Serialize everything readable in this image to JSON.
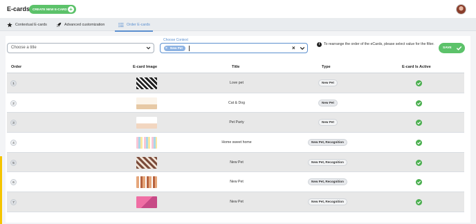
{
  "header": {
    "app_title": "E-cards",
    "create_button": "CREATE NEW E-CARD",
    "avatar_icon": "user-avatar"
  },
  "tabs": [
    {
      "label": "Contextual E-cards",
      "icon": "star-icon",
      "active": false
    },
    {
      "label": "Advanced customization",
      "icon": "rocket-icon",
      "active": false
    },
    {
      "label": "Order E-cards",
      "icon": "list-icon",
      "active": true
    }
  ],
  "filters": {
    "title_placeholder": "Choose a title",
    "context_label": "Choose Context",
    "context_chip": "New Pet",
    "info_text": "To rearrange the order of the eCards, please select value for the filter.",
    "save_label": "SAVE"
  },
  "table": {
    "columns": [
      "Order",
      "E-card Image",
      "Title",
      "Type",
      "E-card Is Active"
    ],
    "rows": [
      {
        "order": "1",
        "title": "Love pet",
        "type": "New Pet",
        "active": true
      },
      {
        "order": "2",
        "title": "Cat & Dog",
        "type": "New Pet",
        "active": true
      },
      {
        "order": "3",
        "title": "Pet Party",
        "type": "New Pet",
        "active": true
      },
      {
        "order": "4",
        "title": "Home sweet home",
        "type": "New Pet, Recognition",
        "active": true
      },
      {
        "order": "5",
        "title": "New Pet",
        "type": "New Pet, Recognition",
        "active": true
      },
      {
        "order": "6",
        "title": "New Pet",
        "type": "New Pet, Recognition",
        "active": true
      },
      {
        "order": "7",
        "title": "New Pet",
        "type": "New Pet, Recognition",
        "active": true
      }
    ]
  },
  "colors": {
    "accent_green": "#5cc26a",
    "accent_blue": "#5b8fcf",
    "active_check": "#4caf50"
  }
}
